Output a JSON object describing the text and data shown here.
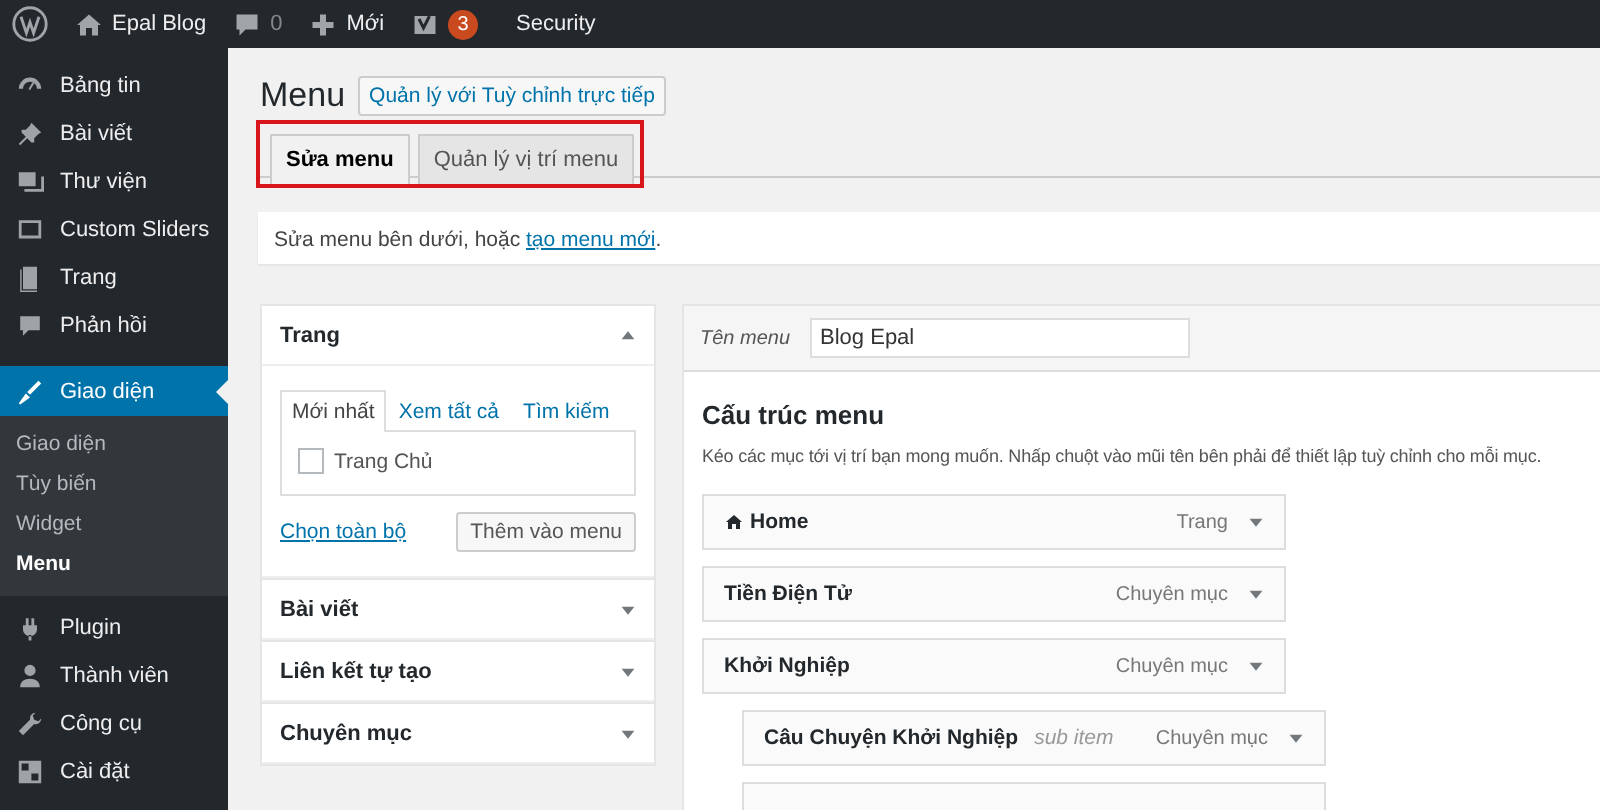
{
  "admin_bar": {
    "site_name": "Epal Blog",
    "comments_count": "0",
    "new_label": "Mới",
    "notifications_count": "3",
    "security_label": "Security"
  },
  "sidebar": {
    "items": [
      {
        "label": "Bảng tin",
        "selected": false
      },
      {
        "label": "Bài viết",
        "selected": false
      },
      {
        "label": "Thư viện",
        "selected": false
      },
      {
        "label": "Custom Sliders",
        "selected": false
      },
      {
        "label": "Trang",
        "selected": false
      },
      {
        "label": "Phản hồi",
        "selected": false
      },
      {
        "label": "Giao diện",
        "selected": true,
        "children": [
          {
            "label": "Giao diện",
            "selected": false
          },
          {
            "label": "Tùy biến",
            "selected": false
          },
          {
            "label": "Widget",
            "selected": false
          },
          {
            "label": "Menu",
            "selected": true
          }
        ]
      },
      {
        "label": "Plugin",
        "selected": false
      },
      {
        "label": "Thành viên",
        "selected": false
      },
      {
        "label": "Công cụ",
        "selected": false
      },
      {
        "label": "Cài đặt",
        "selected": false
      }
    ]
  },
  "page": {
    "title": "Menu",
    "customize_button": "Quản lý với Tuỳ chỉnh trực tiếp",
    "tabs": [
      {
        "label": "Sửa menu",
        "selected": true
      },
      {
        "label": "Quản lý vị trí menu",
        "selected": false
      }
    ],
    "notice": {
      "text": "Sửa menu bên dưới, hoặc ",
      "link": "tạo menu mới",
      "end": "."
    }
  },
  "add_items": {
    "panels": [
      {
        "title": "Trang",
        "expanded": true,
        "tabs": [
          {
            "label": "Mới nhất",
            "selected": true
          },
          {
            "label": "Xem tất cả",
            "selected": false
          },
          {
            "label": "Tìm kiếm",
            "selected": false
          }
        ],
        "options": [
          {
            "label": "Trang Chủ",
            "checked": false
          }
        ],
        "select_all": "Chọn toàn bộ",
        "add_button": "Thêm vào menu"
      },
      {
        "title": "Bài viết",
        "expanded": false
      },
      {
        "title": "Liên kết tự tạo",
        "expanded": false
      },
      {
        "title": "Chuyên mục",
        "expanded": false
      }
    ]
  },
  "menu_editor": {
    "name_label": "Tên menu",
    "name_value": "Blog Epal",
    "structure_title": "Cấu trúc menu",
    "structure_hint": "Kéo các mục tới vị trí bạn mong muốn. Nhấp chuột vào mũi tên bên phải để thiết lập tuỳ chỉnh cho mỗi mục.",
    "items": [
      {
        "title": "Home",
        "home_icon": true,
        "type": "Trang"
      },
      {
        "title": "Tiền Điện Tử",
        "type": "Chuyên mục"
      },
      {
        "title": "Khởi Nghiệp",
        "type": "Chuyên mục",
        "children": [
          {
            "title": "Câu Chuyện Khởi Nghiệp",
            "note": "sub item",
            "type": "Chuyên mục"
          },
          {
            "kind": "cut_off"
          }
        ]
      }
    ]
  }
}
